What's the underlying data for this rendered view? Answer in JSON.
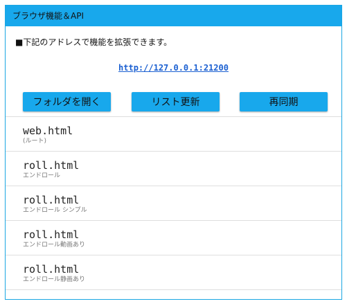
{
  "header": {
    "title": "ブラウザ機能＆API"
  },
  "description": "■下記のアドレスで機能を拡張できます。",
  "url": "http://127.0.0.1:21200",
  "buttons": {
    "open_folder": "フォルダを開く",
    "refresh_list": "リスト更新",
    "resync": "再同期"
  },
  "files": [
    {
      "name": "web.html",
      "desc": "(ルート)"
    },
    {
      "name": "roll.html",
      "desc": "エンドロール"
    },
    {
      "name": "roll.html",
      "desc": "エンドロール シンプル"
    },
    {
      "name": "roll.html",
      "desc": "エンドロール動画あり"
    },
    {
      "name": "roll.html",
      "desc": "エンドロール静画あり"
    }
  ],
  "colors": {
    "accent": "#18a8ec",
    "link": "#1a5fd1",
    "border": "#1aa6e3"
  }
}
